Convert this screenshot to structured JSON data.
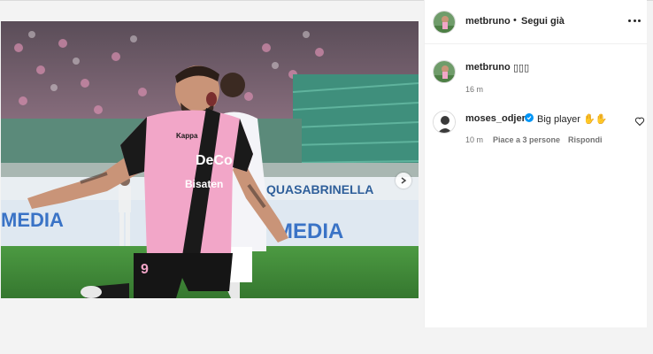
{
  "post": {
    "username": "metbruno",
    "follow_separator": "•",
    "follow_status": "Segui già",
    "more_options": "more-options-icon",
    "image_alt": "footballer celebrating in pink Palermo kit with number 9",
    "carousel": {
      "total": 2,
      "active": 0
    }
  },
  "caption": {
    "username": "metbruno",
    "text": "▯▯▯",
    "time": "16 m"
  },
  "comment": {
    "username": "moses_odjer",
    "verified": true,
    "text": "Big player ✋✋",
    "time": "10 m",
    "likes": "Piace a 3 persone",
    "reply": "Rispondi"
  },
  "banners": {
    "top": "QUASABRINELLA",
    "bottom": "MEDIA",
    "bottom_right": "MEDIA"
  },
  "jersey": {
    "sponsor": "DeCo",
    "sponsor2": "Bisaten",
    "number": "9",
    "brand": "Kappa"
  },
  "colors": {
    "accent": "#0095f6",
    "jersey_pink": "#f2a6c8",
    "jersey_black": "#1a1a1a",
    "pitch": "#3f8a3a"
  }
}
